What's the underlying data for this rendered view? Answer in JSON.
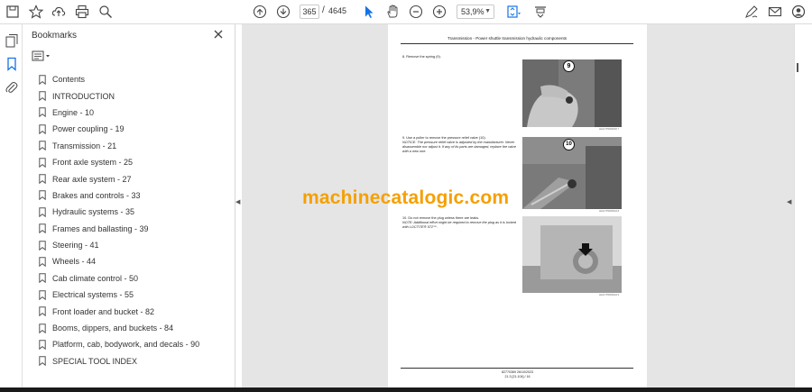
{
  "toolbar": {
    "page_current": "365",
    "page_separator": "/",
    "page_total": "4645",
    "zoom": "53,9%"
  },
  "panel": {
    "title": "Bookmarks",
    "items": [
      {
        "label": "Contents"
      },
      {
        "label": "INTRODUCTION"
      },
      {
        "label": "Engine - 10"
      },
      {
        "label": "Power coupling - 19"
      },
      {
        "label": "Transmission - 21"
      },
      {
        "label": "Front axle system - 25"
      },
      {
        "label": "Rear axle system - 27"
      },
      {
        "label": "Brakes and controls - 33"
      },
      {
        "label": "Hydraulic systems - 35"
      },
      {
        "label": "Frames and ballasting - 39"
      },
      {
        "label": "Steering - 41"
      },
      {
        "label": "Wheels - 44"
      },
      {
        "label": "Cab climate control - 50"
      },
      {
        "label": "Electrical systems - 55"
      },
      {
        "label": "Front loader and bucket - 82"
      },
      {
        "label": "Booms, dippers, and buckets - 84"
      },
      {
        "label": "Platform, cab, bodywork, and decals - 90"
      },
      {
        "label": "SPECIAL TOOL INDEX"
      }
    ]
  },
  "document": {
    "header": "Transmission - Power shuttle transmission hydraulic components",
    "step8": "8.  Remove the spring (9).",
    "step9": "9.  Use a puller to remove the pressure relief valve (10).",
    "step9_note": "NOTICE: The pressure relief valve is adjusted by the manufacturer. Never disassemble nor adjust it. If any of its parts are damaged, replace the valve with a new one.",
    "step10": "10.  Do not remove the plug unless there are leaks.",
    "step10_note": "NOTE: Additional effort might be required to remove the plug as it is locked with LOCTITE® 572™.",
    "callout1": "9",
    "callout2": "10",
    "caption1": "LEIL17TR0000A5   7",
    "caption2": "LEIL17TR0000A4   8",
    "caption3": "LEIL17TR0000A4   9",
    "footer_line1": "82770369 26/10/2023",
    "footer_line2": "21.3 [21.104] / 16"
  },
  "watermark": "machinecatalogic.com",
  "colors": {
    "watermark": "#f5a000",
    "doc_background": "#e5e5e5",
    "accent_blue": "#1473e6"
  }
}
